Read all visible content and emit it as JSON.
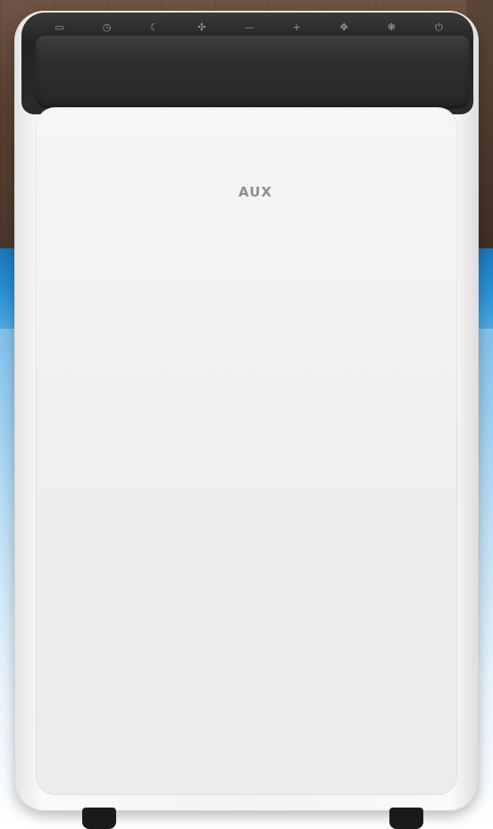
{
  "brand": {
    "logo_text": "AUX"
  },
  "control_panel": {
    "buttons": [
      {
        "icon": "mode-icon",
        "glyph": "▭"
      },
      {
        "icon": "timer-icon",
        "glyph": "◷"
      },
      {
        "icon": "sleep-icon",
        "glyph": "☾"
      },
      {
        "icon": "fan-speed-icon",
        "glyph": "✣"
      },
      {
        "icon": "minus-icon",
        "glyph": "—"
      },
      {
        "icon": "plus-icon",
        "glyph": "+"
      },
      {
        "icon": "swing-icon",
        "glyph": "✥"
      },
      {
        "icon": "fan-icon",
        "glyph": "❋"
      },
      {
        "icon": "power-icon",
        "glyph": "⏻"
      }
    ]
  },
  "colors": {
    "body": "#f4f4f4",
    "bezel": "#2a2a2a",
    "logo": "#8f8f8f",
    "backdrop_blue": "#2b93d6"
  }
}
